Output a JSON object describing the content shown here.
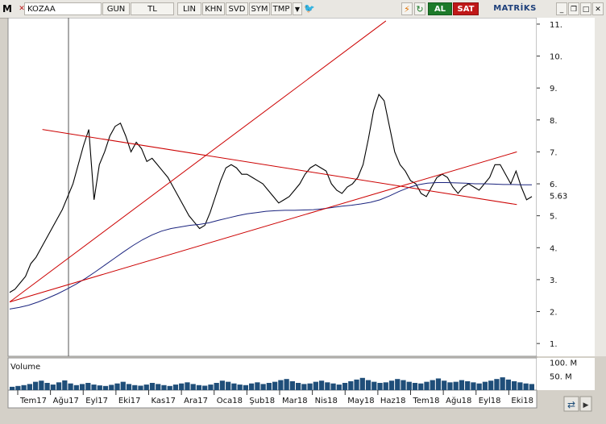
{
  "toolbar": {
    "menu_label": "M",
    "symbol": "KOZAA",
    "period": "GUN",
    "currency": "TL",
    "scale": "LIN",
    "khn": "KHN",
    "svd": "SVD",
    "sym": "SYM",
    "tmp": "TMP",
    "buy": "AL",
    "sell": "SAT",
    "brand": "MATRİKS",
    "colors": {
      "buy": "#1d7a2a",
      "sell": "#c01818",
      "twitter": "#1da1f2"
    }
  },
  "chart_data": [
    {
      "type": "line",
      "panel": "price",
      "title": "",
      "xlabel": "",
      "ylabel": "",
      "ylim": [
        0.6,
        11.2
      ],
      "yticks": [
        "1.",
        "2.",
        "3.",
        "4.",
        "5.",
        "6.",
        "7.",
        "8.",
        "9.",
        "10.",
        "11."
      ],
      "last_value_label": "5.63",
      "x": [
        "Tem17",
        "Ağu17",
        "Eyl17",
        "Eki17",
        "Kas17",
        "Ara17",
        "Oca18",
        "Şub18",
        "Mar18",
        "Nis18",
        "May18",
        "Haz18",
        "Tem18",
        "Ağu18",
        "Eyl18",
        "Eki18"
      ],
      "series": [
        {
          "values": [
            2.6,
            2.7,
            2.9,
            3.1,
            3.5,
            3.7,
            4.0,
            4.3,
            4.6,
            4.9,
            5.2,
            5.6,
            6.0,
            6.6,
            7.2,
            7.7,
            5.5,
            6.6,
            7.0,
            7.5,
            7.8,
            7.9,
            7.5,
            7.0,
            7.3,
            7.1,
            6.7,
            6.8,
            6.6,
            6.4,
            6.2,
            5.9,
            5.6,
            5.3,
            5.0,
            4.8,
            4.6,
            4.7,
            5.1,
            5.6,
            6.1,
            6.5,
            6.6,
            6.5,
            6.3,
            6.3,
            6.2,
            6.1,
            6.0,
            5.8,
            5.6,
            5.4,
            5.5,
            5.6,
            5.8,
            6.0,
            6.3,
            6.5,
            6.6,
            6.5,
            6.4,
            6.0,
            5.8,
            5.7,
            5.9,
            6.0,
            6.2,
            6.6,
            7.4,
            8.3,
            8.8,
            8.6,
            7.8,
            7.0,
            6.6,
            6.4,
            6.1,
            6.0,
            5.7,
            5.6,
            5.9,
            6.2,
            6.3,
            6.2,
            5.9,
            5.7,
            5.9,
            6.0,
            5.9,
            5.8,
            6.0,
            6.2,
            6.6,
            6.6,
            6.3,
            6.0,
            6.4,
            5.9,
            5.5,
            5.6
          ],
          "color": "#000000"
        },
        {
          "values": [
            2.08,
            2.13,
            2.2,
            2.3,
            2.42,
            2.55,
            2.7,
            2.86,
            3.04,
            3.24,
            3.45,
            3.66,
            3.87,
            4.07,
            4.25,
            4.4,
            4.52,
            4.6,
            4.65,
            4.7,
            4.73,
            4.78,
            4.86,
            4.93,
            5.0,
            5.06,
            5.1,
            5.14,
            5.16,
            5.17,
            5.17,
            5.18,
            5.19,
            5.22,
            5.26,
            5.3,
            5.33,
            5.37,
            5.42,
            5.5,
            5.62,
            5.76,
            5.88,
            5.97,
            6.02,
            6.04,
            6.04,
            6.03,
            6.02,
            6.0,
            6.0,
            5.99,
            5.98,
            5.98,
            5.97,
            5.97
          ],
          "color": "#1a237e"
        }
      ],
      "trendlines": [
        {
          "x": [
            "Tem17",
            "Haz18"
          ],
          "y": [
            2.3,
            11.1
          ],
          "color": "#cc0000"
        },
        {
          "x": [
            "Ağu17",
            "Eki18"
          ],
          "y": [
            7.7,
            5.35
          ],
          "color": "#cc0000"
        },
        {
          "x": [
            "Tem17",
            "Eki18"
          ],
          "y": [
            2.3,
            7.0
          ],
          "color": "#cc0000"
        }
      ],
      "grid": false
    },
    {
      "type": "bar",
      "panel": "volume",
      "title": "Volume",
      "ylim": [
        0,
        110
      ],
      "yticks": [
        "100. M",
        "50. M"
      ],
      "series": [
        {
          "name": "Volume",
          "values": [
            12,
            15,
            18,
            22,
            30,
            34,
            26,
            20,
            28,
            35,
            24,
            18,
            22,
            26,
            20,
            17,
            15,
            19,
            24,
            30,
            22,
            18,
            16,
            20,
            26,
            22,
            18,
            15,
            20,
            24,
            28,
            22,
            18,
            16,
            20,
            26,
            34,
            30,
            24,
            20,
            18,
            24,
            28,
            22,
            26,
            30,
            36,
            40,
            32,
            26,
            22,
            24,
            30,
            34,
            28,
            24,
            20,
            26,
            32,
            38,
            44,
            36,
            30,
            26,
            28,
            34,
            40,
            36,
            30,
            26,
            24,
            30,
            36,
            42,
            34,
            28,
            30,
            36,
            32,
            28,
            24,
            30,
            34,
            40,
            46,
            38,
            32,
            28,
            24,
            22
          ],
          "color": "#1f4e79"
        }
      ]
    }
  ]
}
